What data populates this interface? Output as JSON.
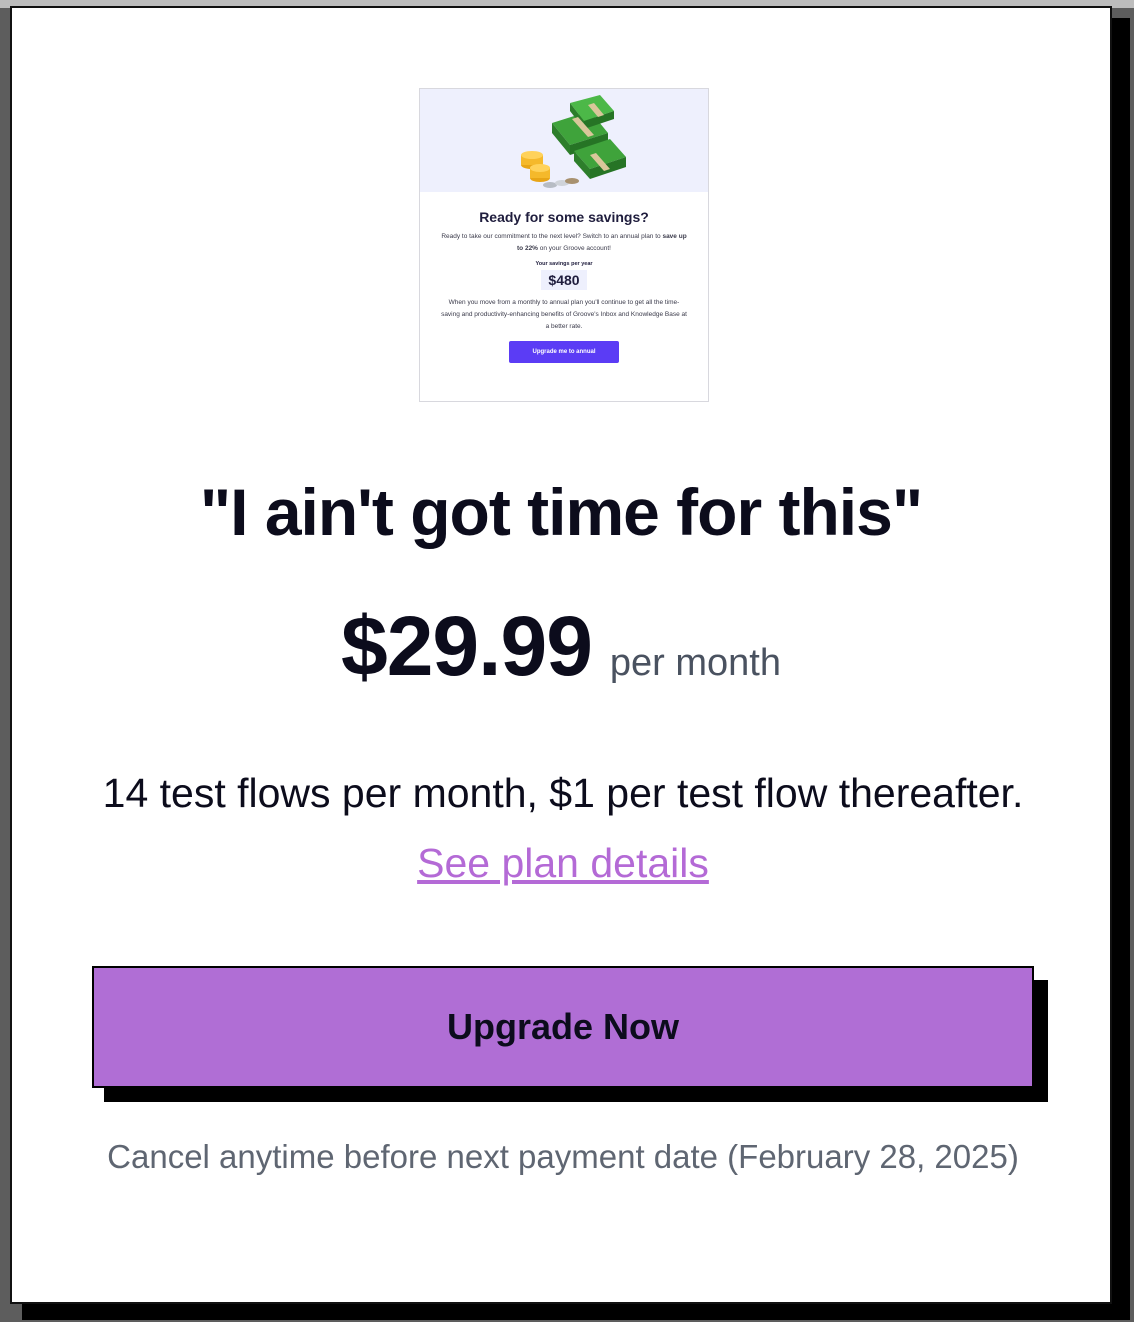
{
  "preview": {
    "title": "Ready for some savings?",
    "body_prefix": "Ready to take our commitment to the next level? Switch to an annual plan to ",
    "body_bold": "save up to 22%",
    "body_suffix": " on your Groove account!",
    "savings_label": "Your savings per year",
    "savings_amount": "$480",
    "body2": "When you move from a monthly to annual plan you'll continue to get all the time-saving and productivity-enhancing benefits of Groove's Inbox and Knowledge Base at a better rate.",
    "button_label": "Upgrade me to annual",
    "illustration": "money-stack-icon"
  },
  "plan": {
    "headline": "\"I ain't got time for this\"",
    "price": "$29.99",
    "period": "per month",
    "description": "14 test flows per month, $1 per test flow thereafter.",
    "link_label": "See plan details"
  },
  "upgrade_button_label": "Upgrade Now",
  "cancel_note": "Cancel anytime before next payment date (February 28, 2025)",
  "colors": {
    "accent": "#b06ed5",
    "link": "#b46ad6",
    "preview_button": "#5b3cf5"
  }
}
